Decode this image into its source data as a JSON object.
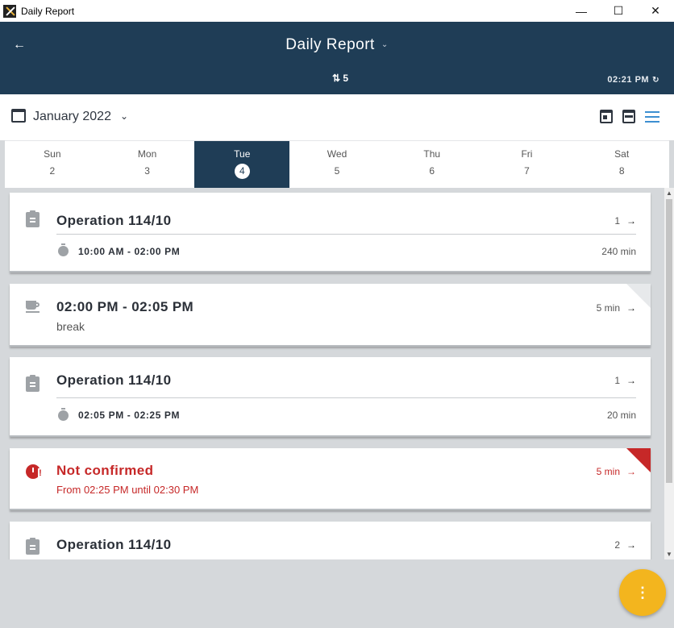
{
  "window": {
    "title": "Daily Report",
    "minimize": "—",
    "maximize": "☐",
    "close": "✕"
  },
  "header": {
    "back_icon": "←",
    "title": "Daily Report",
    "title_chevron": "⌄",
    "sync_count": "5",
    "time": "02:21 PM",
    "refresh_icon": "↻"
  },
  "month": {
    "label": "January 2022",
    "chevron": "⌄"
  },
  "week": [
    {
      "name": "Sun",
      "date": "2"
    },
    {
      "name": "Mon",
      "date": "3"
    },
    {
      "name": "Tue",
      "date": "4"
    },
    {
      "name": "Wed",
      "date": "5"
    },
    {
      "name": "Thu",
      "date": "6"
    },
    {
      "name": "Fri",
      "date": "7"
    },
    {
      "name": "Sat",
      "date": "8"
    }
  ],
  "entries": [
    {
      "title": "Operation 114/10",
      "count": "1",
      "time_range": "10:00 AM - 02:00 PM",
      "duration": "240 min"
    },
    {
      "title": "02:00 PM - 02:05 PM",
      "duration": "5 min",
      "sub": "break"
    },
    {
      "title": "Operation 114/10",
      "count": "1",
      "time_range": "02:05 PM - 02:25 PM",
      "duration": "20 min"
    },
    {
      "title": "Not confirmed",
      "duration": "5 min",
      "sub": "From 02:25 PM until 02:30 PM",
      "color": "#c62828"
    },
    {
      "title": "Operation 114/10",
      "count": "2"
    }
  ],
  "arrow": "→",
  "fab_label": "⋮",
  "colors": {
    "header": "#1f3d56",
    "accent": "#3d8fd1",
    "fab": "#f3b51e",
    "alert": "#c62828"
  }
}
